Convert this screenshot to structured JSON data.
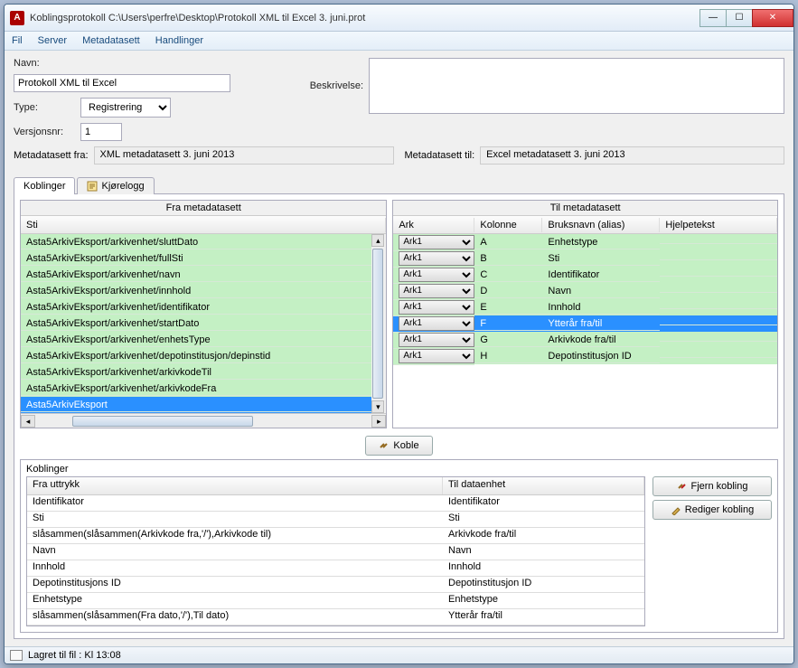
{
  "window": {
    "title": "Koblingsprotokoll C:\\Users\\perfre\\Desktop\\Protokoll XML til Excel 3. juni.prot"
  },
  "menu": [
    "Fil",
    "Server",
    "Metadatasett",
    "Handlinger"
  ],
  "form": {
    "name_label": "Navn:",
    "name": "Protokoll XML til Excel",
    "type_label": "Type:",
    "type": "Registrering",
    "version_label": "Versjonsnr:",
    "version": "1",
    "desc_label": "Beskrivelse:",
    "desc": ""
  },
  "meta": {
    "from_label": "Metadatasett fra:",
    "from": "XML metadatasett 3. juni 2013",
    "to_label": "Metadatasett til:",
    "to": "Excel metadatasett 3. juni 2013"
  },
  "tabs": {
    "koblinger": "Koblinger",
    "kjorelogg": "Kjørelogg"
  },
  "left_pane": {
    "title": "Fra metadatasett",
    "col_sti": "Sti",
    "rows": [
      "Asta5ArkivEksport/arkivenhet/sluttDato",
      "Asta5ArkivEksport/arkivenhet/fullSti",
      "Asta5ArkivEksport/arkivenhet/navn",
      "Asta5ArkivEksport/arkivenhet/innhold",
      "Asta5ArkivEksport/arkivenhet/identifikator",
      "Asta5ArkivEksport/arkivenhet/startDato",
      "Asta5ArkivEksport/arkivenhet/enhetsType",
      "Asta5ArkivEksport/arkivenhet/depotinstitusjon/depinstid",
      "Asta5ArkivEksport/arkivenhet/arkivkodeTil",
      "Asta5ArkivEksport/arkivenhet/arkivkodeFra",
      "Asta5ArkivEksport"
    ],
    "selected": 10
  },
  "right_pane": {
    "title": "Til metadatasett",
    "col_ark": "Ark",
    "col_kol": "Kolonne",
    "col_alias": "Bruksnavn (alias)",
    "col_help": "Hjelpetekst",
    "rows": [
      {
        "ark": "Ark1",
        "kol": "A",
        "alias": "Enhetstype"
      },
      {
        "ark": "Ark1",
        "kol": "B",
        "alias": "Sti"
      },
      {
        "ark": "Ark1",
        "kol": "C",
        "alias": "Identifikator"
      },
      {
        "ark": "Ark1",
        "kol": "D",
        "alias": "Navn"
      },
      {
        "ark": "Ark1",
        "kol": "E",
        "alias": "Innhold"
      },
      {
        "ark": "Ark1",
        "kol": "F",
        "alias": "Ytterår fra/til"
      },
      {
        "ark": "Ark1",
        "kol": "G",
        "alias": "Arkivkode fra/til"
      },
      {
        "ark": "Ark1",
        "kol": "H",
        "alias": "Depotinstitusjon ID"
      }
    ],
    "selected": 5
  },
  "koble_btn": "Koble",
  "koblinger": {
    "section_label": "Koblinger",
    "col_from": "Fra uttrykk",
    "col_to": "Til dataenhet",
    "rows": [
      {
        "f": "Identifikator",
        "t": "Identifikator"
      },
      {
        "f": "Sti",
        "t": "Sti"
      },
      {
        "f": "slåsammen(slåsammen(Arkivkode fra,'/'),Arkivkode til)",
        "t": "Arkivkode fra/til"
      },
      {
        "f": "Navn",
        "t": "Navn"
      },
      {
        "f": "Innhold",
        "t": "Innhold"
      },
      {
        "f": "Depotinstitusjons ID",
        "t": "Depotinstitusjon ID"
      },
      {
        "f": "Enhetstype",
        "t": "Enhetstype"
      },
      {
        "f": "slåsammen(slåsammen(Fra dato,'/'),Til dato)",
        "t": "Ytterår fra/til"
      }
    ],
    "btn_remove": "Fjern kobling",
    "btn_edit": "Rediger kobling"
  },
  "status": "Lagret til fil : Kl 13:08"
}
